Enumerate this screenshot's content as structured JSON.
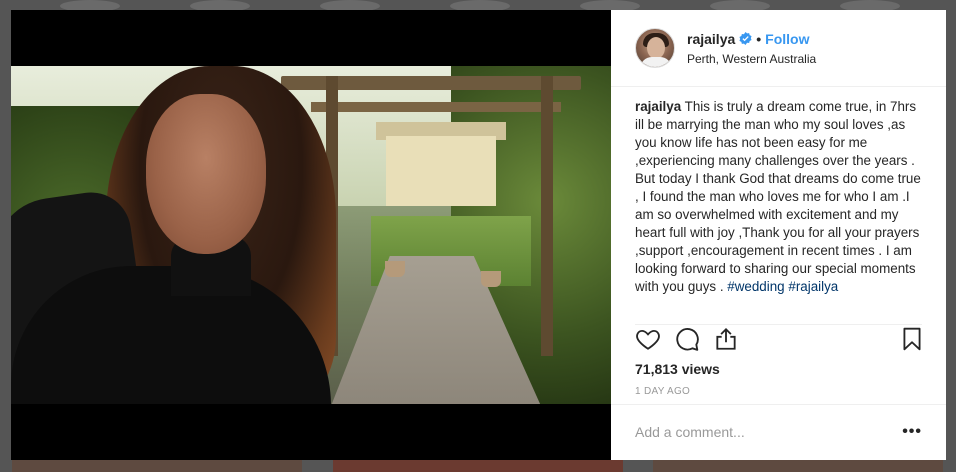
{
  "post": {
    "username": "rajailya",
    "follow_label": "Follow",
    "separator": "•",
    "location": "Perth, Western Australia",
    "caption": {
      "username": "rajailya",
      "text": " This is truly a dream come true, in 7hrs ill be marrying the man who my soul loves ,as you know life has not been easy for me ,experiencing many challenges over the years . But today I thank God that dreams do come true , I found the man who loves me for who I am .I am so overwhelmed with excitement and my heart full with joy ,Thank you for all your prayers ,support ,encouragement in recent times . I am looking forward to sharing our special moments with you guys . ",
      "hashtags": [
        "#wedding",
        "#rajailya"
      ]
    },
    "views": "71,813 views",
    "time_ago": "1 DAY AGO",
    "comment_placeholder": "Add a comment...",
    "more_label": "•••"
  },
  "icons": {
    "verified": "verified-badge-icon",
    "like": "heart-icon",
    "comment": "comment-bubble-icon",
    "share": "share-icon",
    "save": "bookmark-icon"
  },
  "colors": {
    "accent": "#3897f0",
    "hashtag": "#003569",
    "text": "#262626",
    "muted": "#999999"
  }
}
